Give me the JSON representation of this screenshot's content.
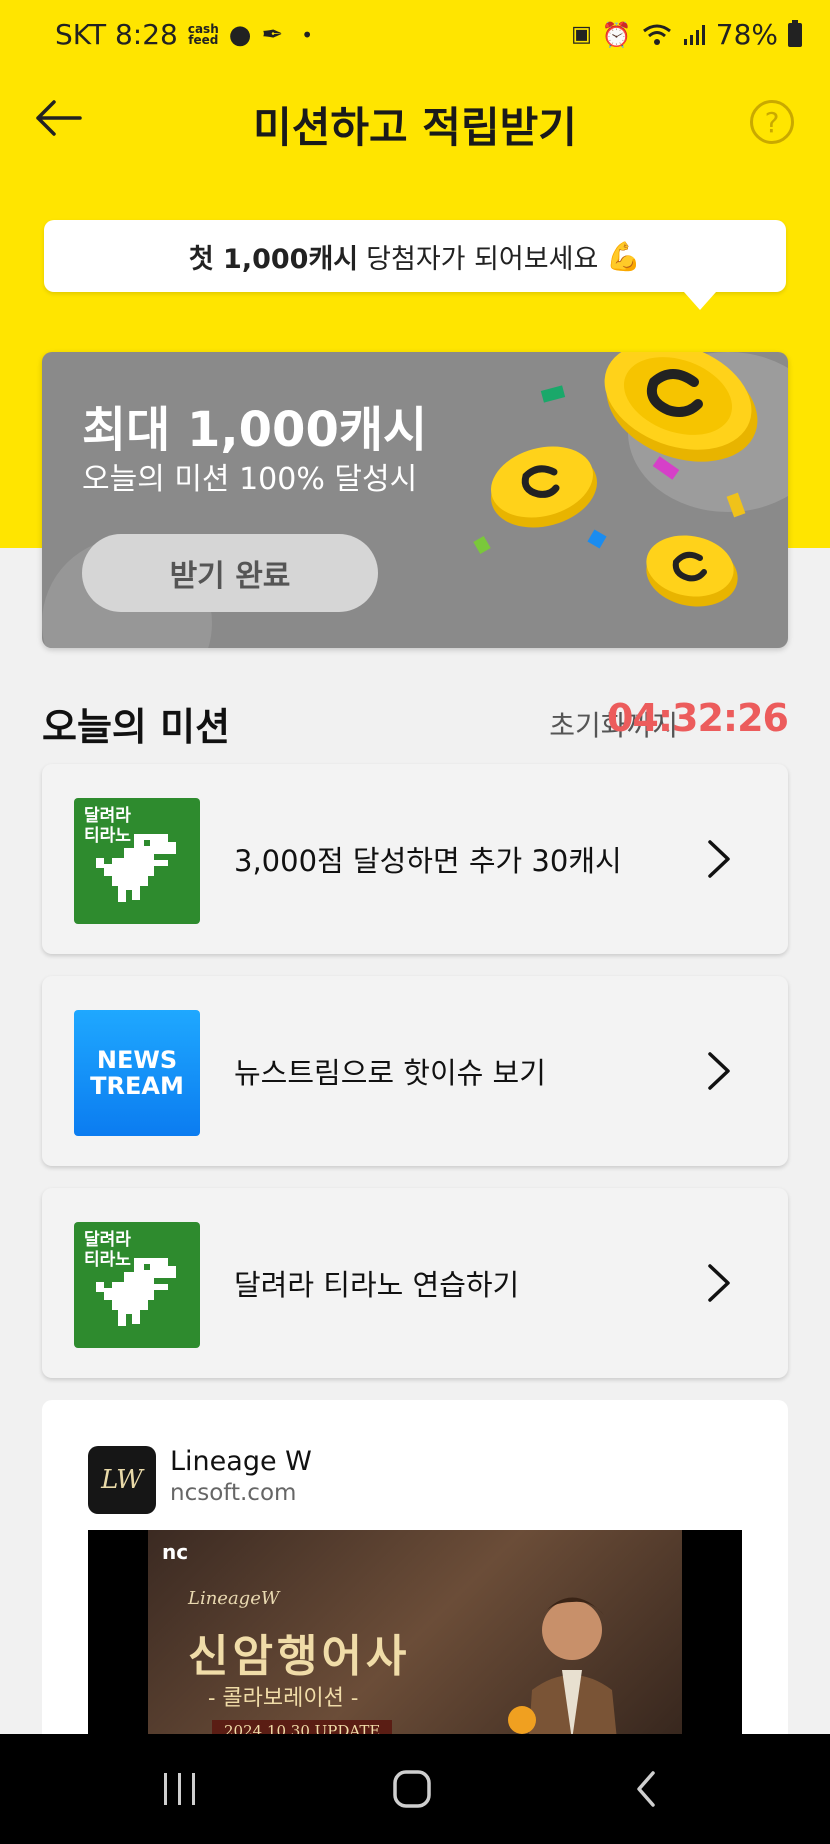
{
  "status_bar": {
    "carrier_time": "SKT 8:28",
    "cashfeed_label": "cash\nfeed",
    "battery": "78%"
  },
  "header": {
    "title": "미션하고 적립받기",
    "help": "?"
  },
  "banner": {
    "bold": "첫 1,000캐시",
    "text": "당첨자가 되어보세요",
    "emoji": "💪"
  },
  "reward": {
    "title": "최대 1,000캐시",
    "subtitle": "오늘의 미션 100% 달성시",
    "button_label": "받기 완료"
  },
  "missions_section": {
    "title": "오늘의 미션",
    "reset_label": "초기화까지",
    "reset_timer": "04:32:26",
    "timer_color": "#ec5c5c"
  },
  "missions": [
    {
      "label": "3,000점 달성하면 추가 30캐시",
      "thumb_text": "달려라\n티라노",
      "icon": "dino-game-icon"
    },
    {
      "label": "뉴스트림으로 핫이슈 보기",
      "thumb_text_1": "NEWS",
      "thumb_text_2": "TREAM",
      "icon": "newstream-icon"
    },
    {
      "label": "달려라 티라노 연습하기",
      "thumb_text": "달려라\n티라노",
      "icon": "dino-game-icon"
    }
  ],
  "ad": {
    "name": "Lineage W",
    "domain": "ncsoft.com",
    "logo_text": "LW",
    "image_nc": "nc",
    "image_brand": "LineageW",
    "image_headline": "신암행어사",
    "image_collab": "- 콜라보레이션 -",
    "image_update": "2024.10.30 UPDATE"
  },
  "colors": {
    "brand_yellow": "#ffe500",
    "card_gray": "#8a8a8a"
  }
}
